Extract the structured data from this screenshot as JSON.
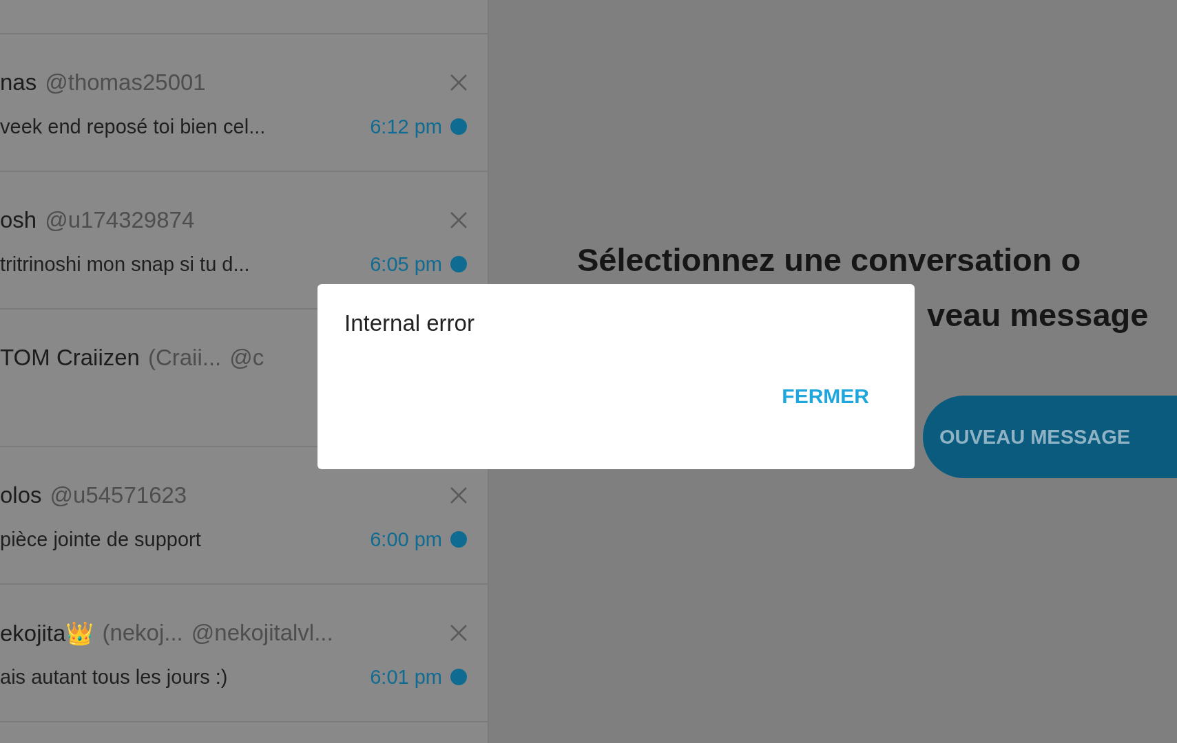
{
  "conversations": [
    {
      "name": "nas",
      "handle": "@thomas25001",
      "preview": "veek end reposé toi bien cel...",
      "time": "6:12 pm",
      "unread": true,
      "closable": true
    },
    {
      "name": "osh",
      "handle": "@u174329874",
      "preview": "tritrinoshi mon snap si tu d...",
      "time": "6:05 pm",
      "unread": true,
      "closable": true
    },
    {
      "name": "TOM Craiizen",
      "display_name": "(Craii...",
      "handle": "@c"
    },
    {
      "name": "olos",
      "handle": "@u54571623",
      "preview": "pièce jointe de support",
      "time": "6:00 pm",
      "unread": true,
      "closable": true
    },
    {
      "name": "ekojita👑",
      "display_name": "(nekoj...",
      "handle": "@nekojitalvl...",
      "preview": "ais autant tous les jours :)",
      "time": "6:01 pm",
      "unread": true,
      "closable": true
    }
  ],
  "main": {
    "heading_lines": [
      "Sélectionnez une conversation o",
      "veau message"
    ],
    "button": "OUVEAU MESSAGE"
  },
  "dialog": {
    "message": "Internal error",
    "button": "FERMER"
  }
}
